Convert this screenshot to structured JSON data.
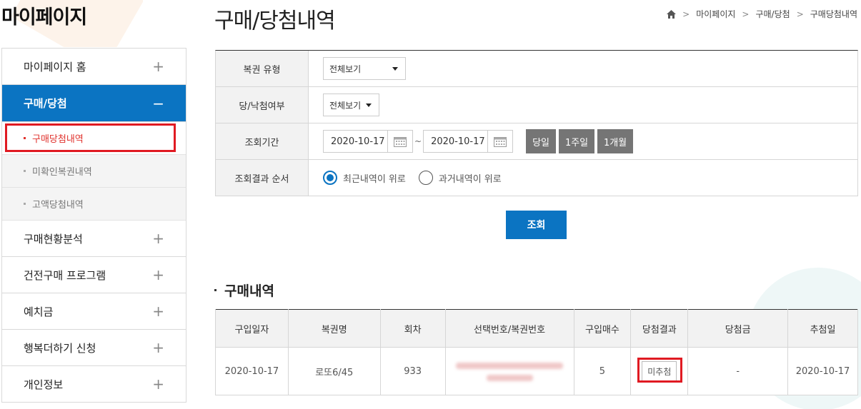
{
  "sidebar": {
    "title": "마이페이지",
    "items": [
      {
        "label": "마이페이지 홈",
        "sign": "+"
      },
      {
        "label": "구매/당첨",
        "sign": "−"
      },
      {
        "label": "구매현황분석",
        "sign": "+"
      },
      {
        "label": "건전구매 프로그램",
        "sign": "+"
      },
      {
        "label": "예치금",
        "sign": "+"
      },
      {
        "label": "행복더하기 신청",
        "sign": "+"
      },
      {
        "label": "개인정보",
        "sign": "+"
      }
    ],
    "subitems": [
      {
        "label": "구매당첨내역"
      },
      {
        "label": "미확인복권내역"
      },
      {
        "label": "고액당첨내역"
      }
    ]
  },
  "header": {
    "title": "구매/당첨내역",
    "breadcrumb": [
      "마이페이지",
      "구매/당첨",
      "구매당첨내역"
    ]
  },
  "search": {
    "lottery_type_label": "복권 유형",
    "lottery_type_value": "전체보기",
    "win_status_label": "당/낙첨여부",
    "win_status_value": "전체보기",
    "period_label": "조회기간",
    "date_from": "2020-10-17",
    "tilde": "~",
    "date_to": "2020-10-17",
    "period_buttons": [
      "당일",
      "1주일",
      "1개월"
    ],
    "order_label": "조회결과 순서",
    "order_options": [
      "최근내역이 위로",
      "과거내역이 위로"
    ],
    "search_button": "조회"
  },
  "results": {
    "title": "구매내역",
    "columns": [
      "구입일자",
      "복권명",
      "회차",
      "선택번호/복권번호",
      "구입매수",
      "당첨결과",
      "당첨금",
      "추첨일"
    ],
    "rows": [
      {
        "date": "2020-10-17",
        "name": "로또6/45",
        "round": "933",
        "count": "5",
        "result": "미추첨",
        "prize": "-",
        "draw_date": "2020-10-17"
      }
    ]
  },
  "colors": {
    "accent": "#0b74c2",
    "highlight": "#e01a22",
    "period_button": "#757575"
  },
  "icons": {
    "home": "home-icon",
    "calendar": "calendar-icon"
  }
}
